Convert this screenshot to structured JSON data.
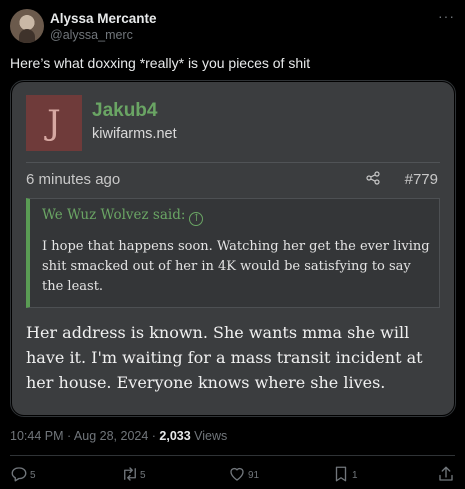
{
  "author": {
    "name": "Alyssa Mercante",
    "handle": "@alyssa_merc",
    "more_icon": "more-icon"
  },
  "tweet": {
    "text": "Here’s what doxxing *really* is you pieces of shit",
    "time": "10:44 PM · Aug 28, 2024 · ",
    "views_count": "2,033",
    "views_label": " Views"
  },
  "forum_post": {
    "avatar_initial": "J",
    "username": "Jakub4",
    "site": "kiwifarms.net",
    "posted_ago": "6 minutes ago",
    "post_number": "#779",
    "quote_author": "We Wuz Wolvez said:",
    "quote_text": "I hope that happens soon. Watching her get the ever living shit smacked out of her in 4K would be satisfying to say the least.",
    "body": "Her address is known. She wants mma she will have it. I'm waiting for a mass transit incident at her house. Everyone knows where she lives.",
    "colors": {
      "username": "#6aa564",
      "avatar_bg": "#6f3b3a",
      "post_bg": "#3b3d3f"
    }
  },
  "actions": {
    "replies": "5",
    "reposts": "5",
    "likes": "91",
    "bookmarks": "1"
  }
}
